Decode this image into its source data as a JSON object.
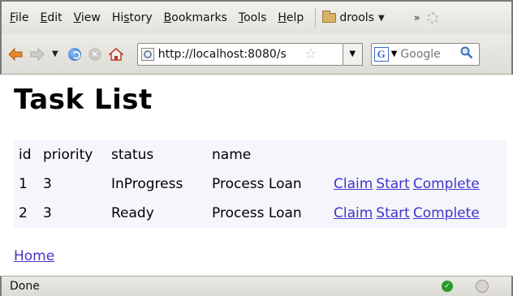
{
  "menu": {
    "items": [
      {
        "acc": "F",
        "rest": "ile"
      },
      {
        "acc": "E",
        "rest": "dit"
      },
      {
        "acc": "V",
        "rest": "iew"
      },
      {
        "pre": "Hi",
        "acc": "s",
        "rest": "tory"
      },
      {
        "acc": "B",
        "rest": "ookmarks"
      },
      {
        "acc": "T",
        "rest": "ools"
      },
      {
        "acc": "H",
        "rest": "elp"
      }
    ],
    "bookmark_folder": "drools",
    "overflow": "»"
  },
  "navbar": {
    "url": "http://localhost:8080/s",
    "search_placeholder": "Google",
    "search_engine": "G"
  },
  "page": {
    "title": "Task List",
    "table": {
      "headers": [
        "id",
        "priority",
        "status",
        "name"
      ],
      "rows": [
        {
          "id": "1",
          "priority": "3",
          "status": "InProgress",
          "name": "Process Loan"
        },
        {
          "id": "2",
          "priority": "3",
          "status": "Ready",
          "name": "Process Loan"
        }
      ],
      "actions": [
        "Claim",
        "Start",
        "Complete"
      ]
    },
    "home_link": "Home"
  },
  "statusbar": {
    "text": "Done"
  },
  "colors": {
    "link": "#4432c9",
    "table_bg": "#f5f6fb",
    "chrome": "#e4e2dd"
  }
}
